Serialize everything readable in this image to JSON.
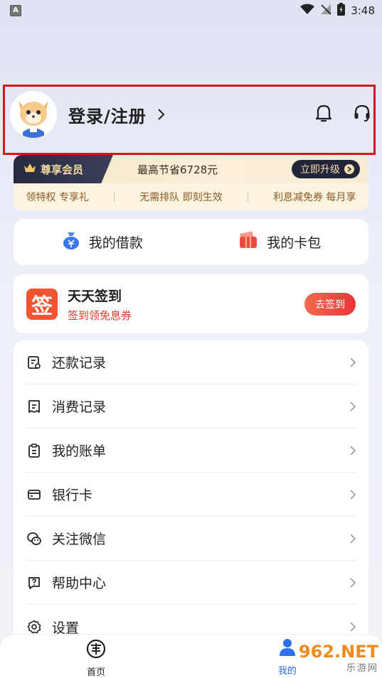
{
  "status_bar": {
    "time": "3:48",
    "left_icon": "A"
  },
  "profile": {
    "login_label": "登录/注册",
    "icons": [
      "bell-icon",
      "headset-icon"
    ]
  },
  "member": {
    "tag": "尊享会员",
    "save_text": "最高节省6728元",
    "upgrade_label": "立即升级",
    "perks": [
      "领特权 专享礼",
      "无需排队 即刻生效",
      "利息减免券 每月享"
    ]
  },
  "quick": {
    "loan_label": "我的借款",
    "wallet_label": "我的卡包"
  },
  "checkin": {
    "logo_char": "签",
    "title": "天天签到",
    "subtitle": "签到领免息券",
    "button_label": "去签到"
  },
  "menu": {
    "items": [
      {
        "label": "还款记录",
        "icon": "repayment-record-icon"
      },
      {
        "label": "消费记录",
        "icon": "receipt-icon"
      },
      {
        "label": "我的账单",
        "icon": "clipboard-icon"
      },
      {
        "label": "银行卡",
        "icon": "bank-card-icon"
      },
      {
        "label": "关注微信",
        "icon": "wechat-icon"
      },
      {
        "label": "帮助中心",
        "icon": "help-icon"
      },
      {
        "label": "设置",
        "icon": "settings-icon"
      }
    ]
  },
  "tabs": {
    "home_label": "首页",
    "mine_label": "我的"
  },
  "watermark": {
    "main": "962.NET",
    "sub": "乐游网"
  },
  "colors": {
    "accent_red": "#e8363b",
    "member_dark": "#22253a",
    "member_gold": "#f5dcae",
    "tab_active": "#2f6fe6",
    "highlight_box": "#d0181e"
  }
}
